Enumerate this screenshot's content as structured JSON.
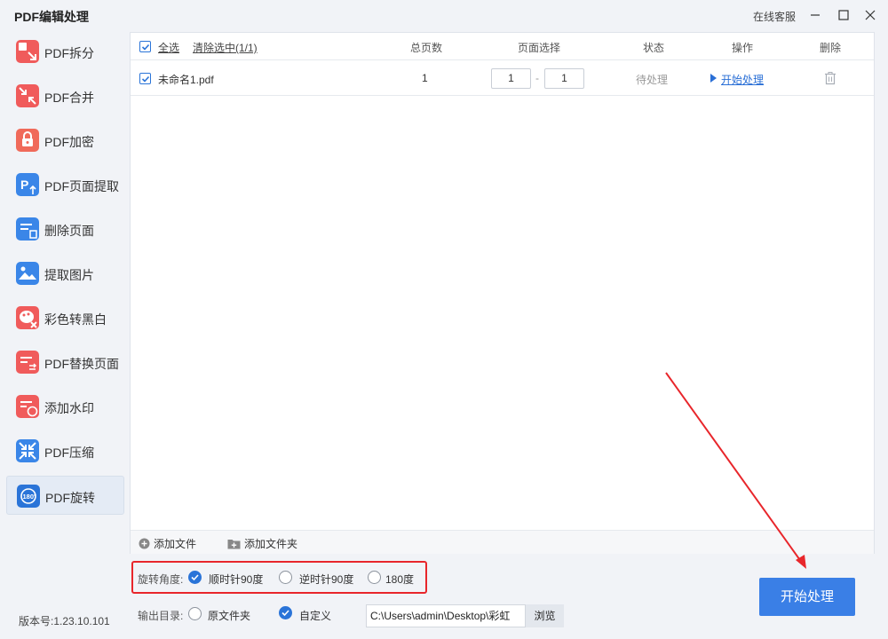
{
  "app": {
    "title": "PDF编辑处理",
    "service": "在线客服"
  },
  "sidebar": {
    "items": [
      {
        "label": "PDF拆分",
        "icon": "split-icon",
        "color": "#f05b5b"
      },
      {
        "label": "PDF合并",
        "icon": "merge-icon",
        "color": "#f05b5b"
      },
      {
        "label": "PDF加密",
        "icon": "lock-icon",
        "color": "#f06a5a"
      },
      {
        "label": "PDF页面提取",
        "icon": "page-extract-icon",
        "color": "#3a86e8"
      },
      {
        "label": "删除页面",
        "icon": "delete-page-icon",
        "color": "#3a86e8"
      },
      {
        "label": "提取图片",
        "icon": "image-icon",
        "color": "#3a86e8"
      },
      {
        "label": "彩色转黑白",
        "icon": "palette-icon",
        "color": "#f05b5b"
      },
      {
        "label": "PDF替换页面",
        "icon": "replace-page-icon",
        "color": "#f05b5b"
      },
      {
        "label": "添加水印",
        "icon": "watermark-icon",
        "color": "#f05b5b"
      },
      {
        "label": "PDF压缩",
        "icon": "compress-icon",
        "color": "#3a86e8"
      },
      {
        "label": "PDF旋转",
        "icon": "rotate-icon",
        "color": "#2a74d8",
        "active": true
      }
    ],
    "version": "版本号:1.23.10.101"
  },
  "table": {
    "select_all": "全选",
    "clear_selection": "清除选中(1/1)",
    "headers": {
      "total_pages": "总页数",
      "page_select": "页面选择",
      "status": "状态",
      "action": "操作",
      "delete": "删除"
    },
    "rows": [
      {
        "filename": "未命名1.pdf",
        "total_pages": "1",
        "page_from": "1",
        "page_sep": "-",
        "page_to": "1",
        "status": "待处理",
        "action": "开始处理"
      }
    ]
  },
  "bottom": {
    "add_file": "添加文件",
    "add_folder": "添加文件夹"
  },
  "rotation": {
    "label": "旋转角度:",
    "options": [
      "顺时针90度",
      "逆时针90度",
      "180度"
    ],
    "selected": "顺时针90度"
  },
  "output": {
    "label": "输出目录:",
    "options": [
      "原文件夹",
      "自定义"
    ],
    "selected": "自定义",
    "path": "C:\\Users\\admin\\Desktop\\彩虹",
    "browse": "浏览"
  },
  "start_button": "开始处理",
  "colors": {
    "accent": "#3a7fe6",
    "annotation": "#e8262b"
  }
}
